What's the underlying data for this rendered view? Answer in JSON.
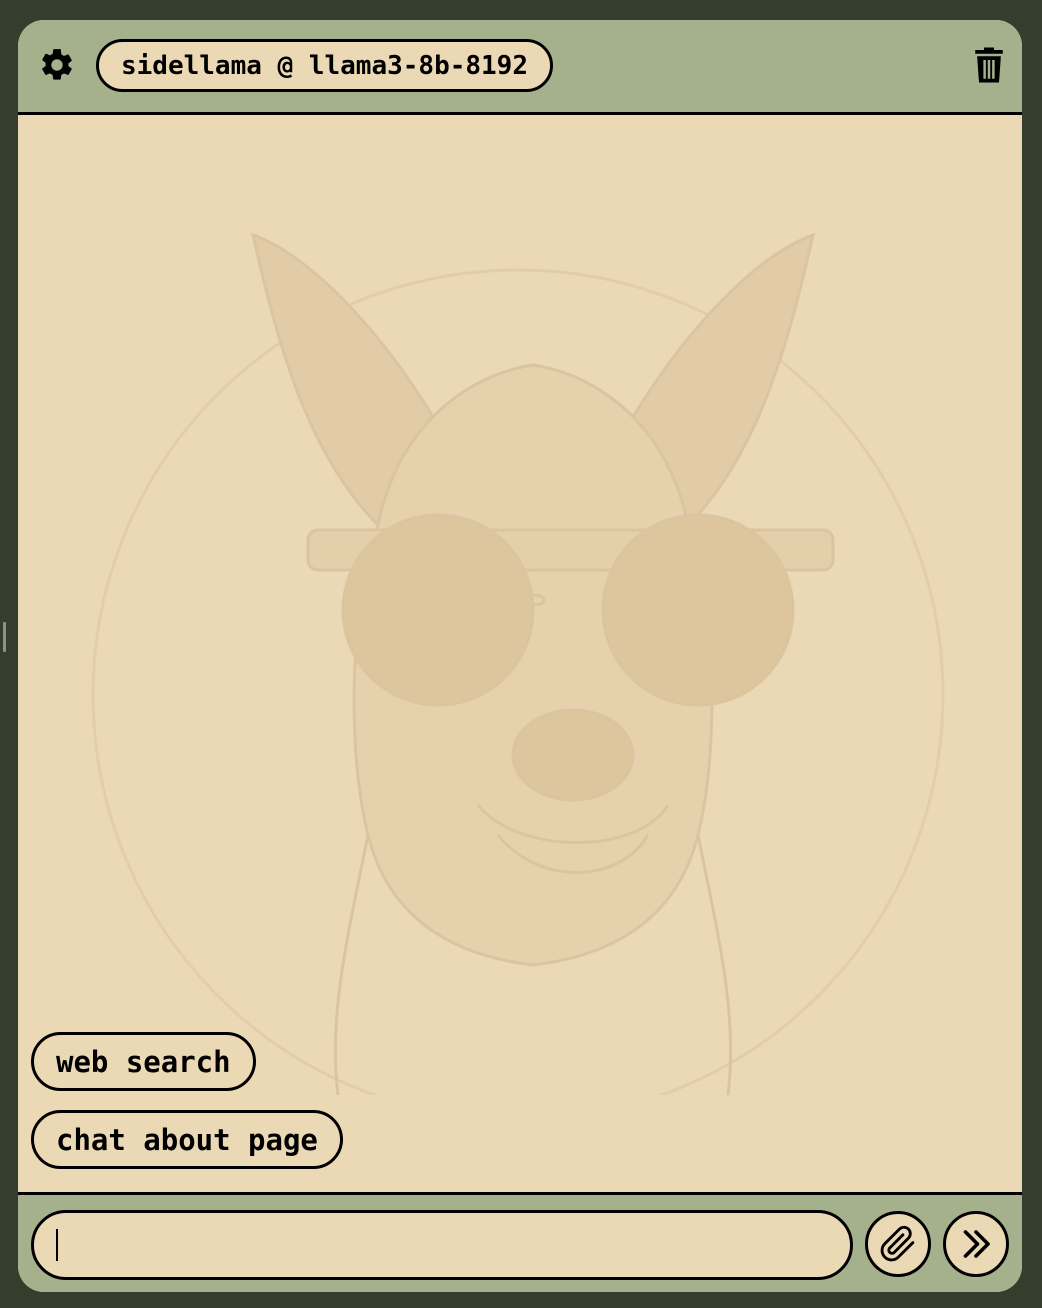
{
  "header": {
    "model_label": "sidellama @ llama3-8b-8192",
    "settings_icon": "gear-icon",
    "clear_icon": "trash-icon"
  },
  "suggestions": [
    {
      "label": "web search"
    },
    {
      "label": "chat about page"
    }
  ],
  "composer": {
    "value": "",
    "placeholder": "",
    "attach_icon": "paperclip-icon",
    "send_icon": "double-chevron-right-icon"
  },
  "background": {
    "illustration": "llama-with-sunglasses"
  },
  "colors": {
    "outer_background": "#333e2d",
    "header_footer": "#a5b08c",
    "surface": "#ebd8b5",
    "ink": "#000000"
  }
}
